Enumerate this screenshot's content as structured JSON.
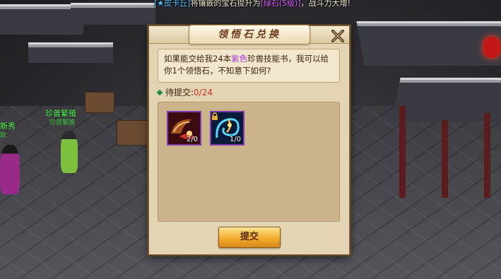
{
  "broadcast": {
    "player": "[★皮卡丘]",
    "text_before": "将镶嵌的宝石提升为",
    "gem": "[绿石(5级)]",
    "text_after": "，战斗力大增!"
  },
  "npcs": [
    {
      "name": "新秀",
      "title": "欧"
    },
    {
      "name": "珍兽繁殖",
      "title": "珍兽繁殖"
    }
  ],
  "dialog": {
    "title": "领悟石兑换",
    "close_icon": "close-x-icon",
    "message_before": "如果能交给我24本",
    "message_highlight": "紫色",
    "message_after": "珍兽技能书，我可以给你1个领悟石，不知意下如何?",
    "highlight_color": "#a93ad8",
    "pending_label": "待提交:",
    "pending_count": "0/24",
    "items": [
      {
        "name": "skill-book-item",
        "count": "2/0",
        "icon": "horn-beast-icon"
      },
      {
        "name": "skill-book-item",
        "count": "1/0",
        "icon": "spirit-swirl-icon",
        "locked": true
      }
    ],
    "submit_label": "提交"
  }
}
